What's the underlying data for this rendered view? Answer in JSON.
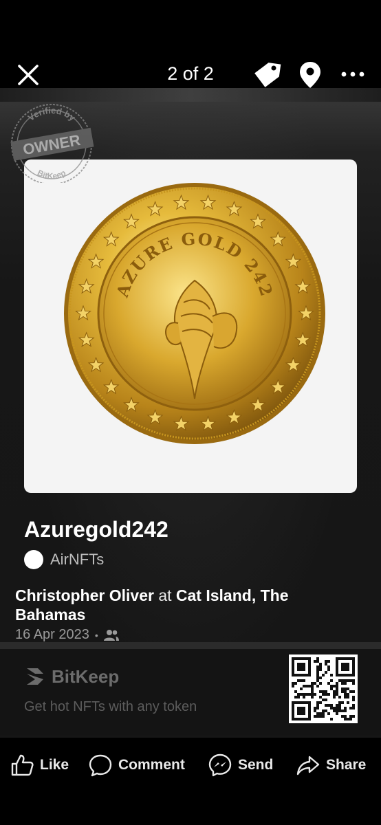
{
  "header": {
    "counter": "2 of 2"
  },
  "badge": {
    "top_text": "Verified by",
    "main_text": "OWNER",
    "bottom_text": "BitKeep"
  },
  "nft": {
    "title": "Azuregold242",
    "collection": "AirNFTs",
    "coin_text": "AZURE GOLD 242"
  },
  "post": {
    "author": "Christopher Oliver",
    "at_word": "at",
    "place": "Cat Island, The Bahamas",
    "date": "16 Apr 2023",
    "separator": "•",
    "audience_icon": "friends-icon"
  },
  "promo": {
    "brand": "BitKeep",
    "tagline": "Get hot NFTs with any token"
  },
  "actions": {
    "like": "Like",
    "comment": "Comment",
    "send": "Send",
    "share": "Share"
  },
  "colors": {
    "gold": "#d4a62a",
    "background": "#000000",
    "card": "#171717"
  }
}
